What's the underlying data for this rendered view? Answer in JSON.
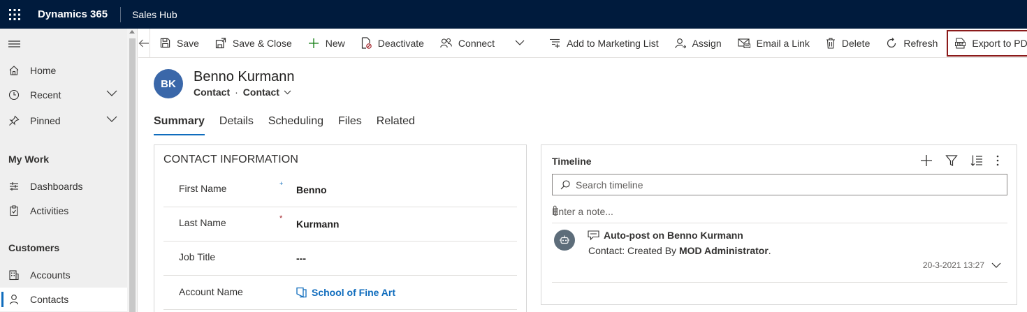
{
  "topbar": {
    "brand": "Dynamics 365",
    "app_name": "Sales Hub"
  },
  "sidebar": {
    "items": [
      {
        "label": "Home",
        "icon": "home-icon"
      },
      {
        "label": "Recent",
        "icon": "clock-icon"
      },
      {
        "label": "Pinned",
        "icon": "pin-icon"
      }
    ],
    "sections": [
      {
        "title": "My Work",
        "items": [
          {
            "label": "Dashboards",
            "icon": "dashboard-icon"
          },
          {
            "label": "Activities",
            "icon": "clipboard-icon"
          }
        ]
      },
      {
        "title": "Customers",
        "items": [
          {
            "label": "Accounts",
            "icon": "building-icon"
          },
          {
            "label": "Contacts",
            "icon": "person-icon",
            "selected": true
          }
        ]
      }
    ]
  },
  "commands": {
    "save": "Save",
    "save_close": "Save & Close",
    "new": "New",
    "deactivate": "Deactivate",
    "connect": "Connect",
    "add_marketing": "Add to Marketing List",
    "assign": "Assign",
    "email_link": "Email a Link",
    "delete": "Delete",
    "refresh": "Refresh",
    "export_pdf": "Export to PDF"
  },
  "record": {
    "initials": "BK",
    "name": "Benno Kurmann",
    "entity": "Contact",
    "separator": "·",
    "form": "Contact"
  },
  "tabs": [
    "Summary",
    "Details",
    "Scheduling",
    "Files",
    "Related"
  ],
  "contact_info": {
    "title": "CONTACT INFORMATION",
    "fields": [
      {
        "label": "First Name",
        "req": "+",
        "value": "Benno"
      },
      {
        "label": "Last Name",
        "req": "*",
        "value": "Kurmann"
      },
      {
        "label": "Job Title",
        "value": "---"
      },
      {
        "label": "Account Name",
        "value": "School of Fine Art"
      }
    ]
  },
  "timeline": {
    "title": "Timeline",
    "search_placeholder": "Search timeline",
    "note_placeholder": "Enter a note...",
    "post": {
      "title": "Auto-post on Benno Kurmann",
      "body_prefix": "Contact: Created By ",
      "body_author": "MOD Administrator",
      "body_suffix": ".",
      "timestamp": "20-3-2021 13:27"
    }
  },
  "colors": {
    "topbar": "#001b3d",
    "accent": "#0f6cbd",
    "export_border": "#8b1a1a",
    "avatar": "#3a67a9"
  }
}
